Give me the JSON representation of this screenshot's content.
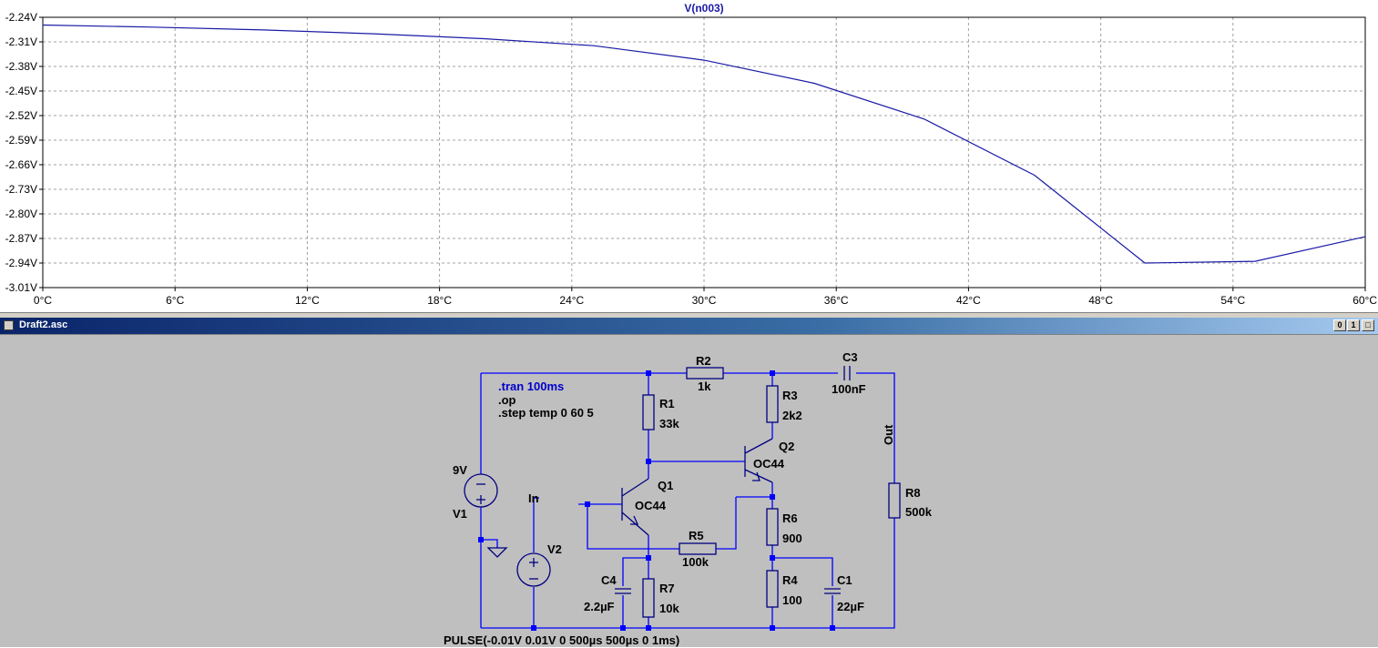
{
  "chart_data": {
    "type": "line",
    "title": "V(n003)",
    "x_ticks": [
      "0°C",
      "6°C",
      "12°C",
      "18°C",
      "24°C",
      "30°C",
      "36°C",
      "42°C",
      "48°C",
      "54°C",
      "60°C"
    ],
    "y_ticks": [
      "-2.24V",
      "-2.31V",
      "-2.38V",
      "-2.45V",
      "-2.52V",
      "-2.59V",
      "-2.66V",
      "-2.73V",
      "-2.80V",
      "-2.87V",
      "-2.94V",
      "-3.01V"
    ],
    "xlim": [
      0,
      60
    ],
    "ylim": [
      -3.01,
      -2.24
    ],
    "grid": true,
    "series": [
      {
        "name": "V(n003)",
        "color": "#1a1aa6",
        "x": [
          0,
          5,
          10,
          15,
          20,
          25,
          30,
          35,
          40,
          45,
          50,
          55,
          60
        ],
        "y": [
          -2.262,
          -2.268,
          -2.276,
          -2.287,
          -2.301,
          -2.321,
          -2.362,
          -2.428,
          -2.53,
          -2.69,
          -2.94,
          -2.935,
          -2.865
        ]
      }
    ]
  },
  "schematic_window": {
    "title": "Draft2.asc",
    "buttons": [
      "0",
      "1",
      "□"
    ]
  },
  "schematic": {
    "directives": [
      ".tran 100ms",
      ".op",
      ".step temp 0 60 5"
    ],
    "components": {
      "R2": {
        "name": "R2",
        "value": "1k"
      },
      "C3": {
        "name": "C3",
        "value": "100nF"
      },
      "R1": {
        "name": "R1",
        "value": "33k"
      },
      "R3": {
        "name": "R3",
        "value": "2k2"
      },
      "Q2": {
        "name": "Q2",
        "value": "OC44"
      },
      "Q1": {
        "name": "Q1",
        "value": "OC44"
      },
      "V1": {
        "name": "V1",
        "value": "9V"
      },
      "V2": {
        "name": "V2",
        "value": "PULSE(-0.01V 0.01V 0 500µs 500µs 0 1ms)"
      },
      "R5": {
        "name": "R5",
        "value": "100k"
      },
      "R6": {
        "name": "R6",
        "value": "900"
      },
      "R8": {
        "name": "R8",
        "value": "500k"
      },
      "C4": {
        "name": "C4",
        "value": "2.2µF"
      },
      "R7": {
        "name": "R7",
        "value": "10k"
      },
      "R4": {
        "name": "R4",
        "value": "100"
      },
      "C1": {
        "name": "C1",
        "value": "22µF"
      }
    },
    "net_labels": {
      "in": "In",
      "out": "Out"
    }
  }
}
